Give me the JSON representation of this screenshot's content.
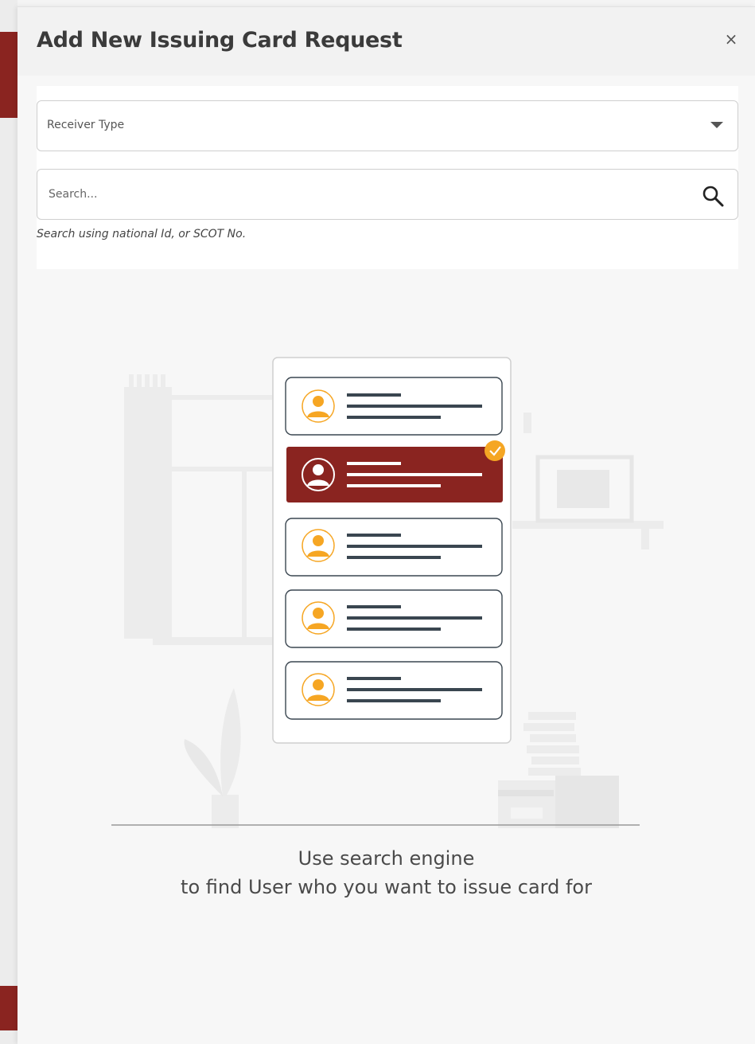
{
  "modal": {
    "title": "Add New Issuing Card Request",
    "close_label": "×"
  },
  "form": {
    "receiver_type": {
      "placeholder": "Receiver Type",
      "value": ""
    },
    "search": {
      "placeholder": "Search...",
      "value": "",
      "helper": "Search using national Id, or SCOT No."
    }
  },
  "empty_state": {
    "line1": "Use search engine",
    "line2": "to find User who you want to issue card for"
  },
  "colors": {
    "accent": "#8a2420",
    "avatar": "#f6a623",
    "check_badge": "#f5a623"
  },
  "icons": [
    "close-icon",
    "caret-down-icon",
    "search-icon",
    "person-icon",
    "check-icon"
  ]
}
